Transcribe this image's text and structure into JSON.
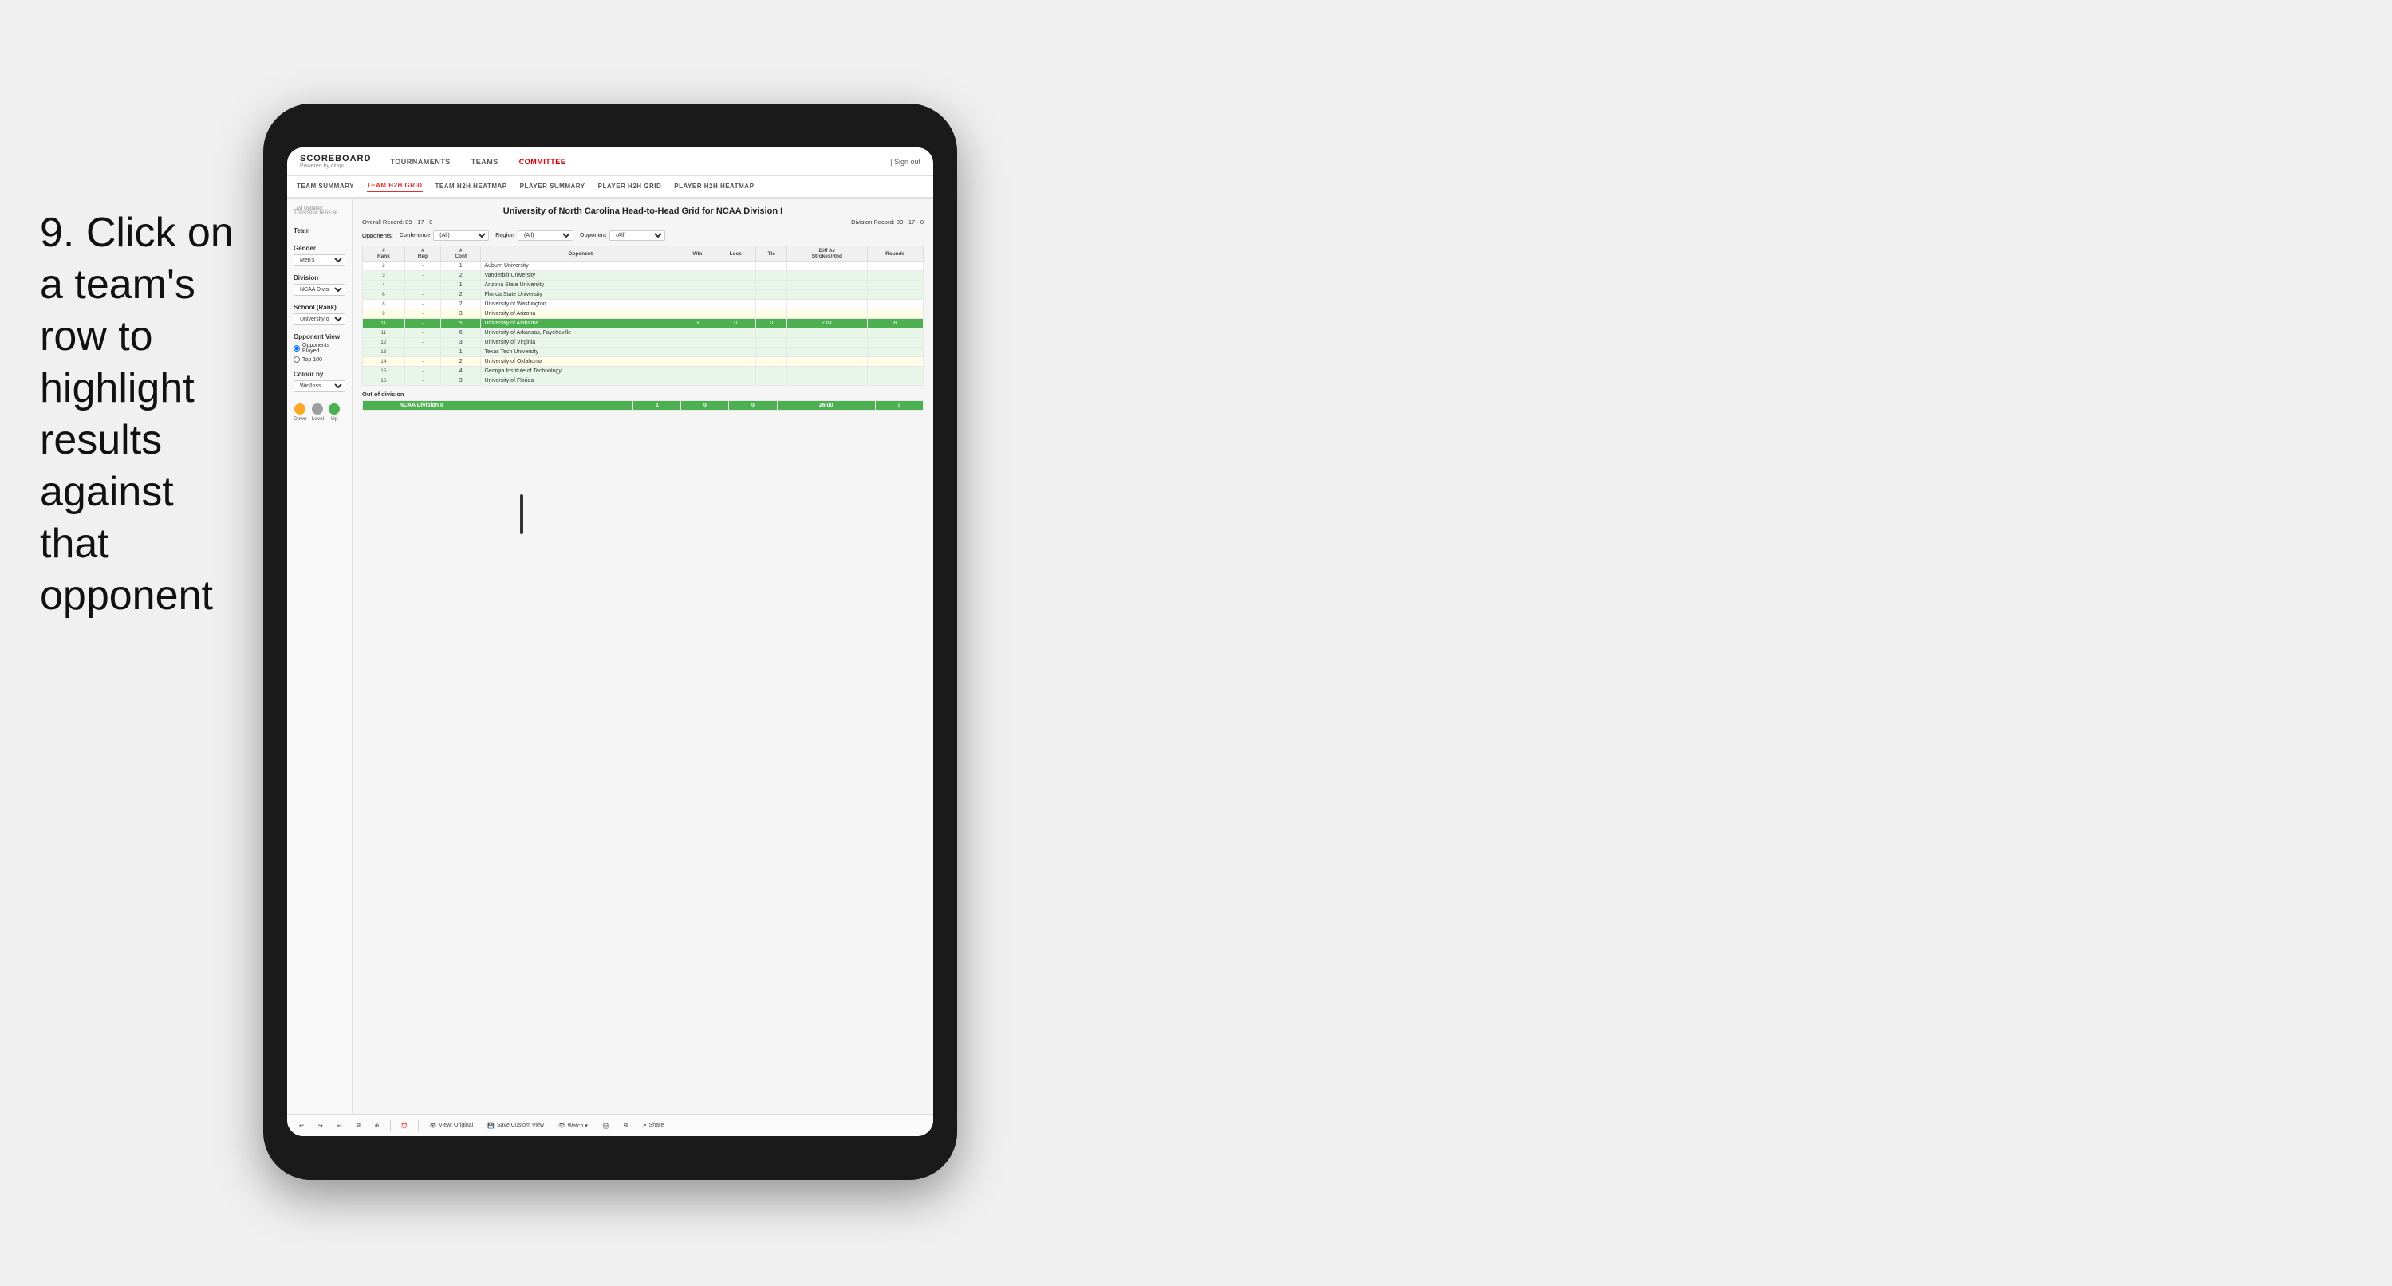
{
  "instruction": {
    "step": "9.",
    "text": "Click on a team's row to highlight results against that opponent"
  },
  "app": {
    "logo": {
      "title": "SCOREBOARD",
      "sub": "Powered by clippi"
    },
    "nav": {
      "links": [
        "TOURNAMENTS",
        "TEAMS",
        "COMMITTEE"
      ],
      "active": "COMMITTEE",
      "sign_out": "Sign out"
    },
    "sub_nav": {
      "links": [
        "TEAM SUMMARY",
        "TEAM H2H GRID",
        "TEAM H2H HEATMAP",
        "PLAYER SUMMARY",
        "PLAYER H2H GRID",
        "PLAYER H2H HEATMAP"
      ],
      "active": "TEAM H2H GRID"
    }
  },
  "sidebar": {
    "meta": "Last Updated: 27/03/2024 16:55:38",
    "team_section": "Team",
    "gender_label": "Gender",
    "gender_value": "Men's",
    "division_label": "Division",
    "division_value": "NCAA Division I",
    "school_label": "School (Rank)",
    "school_value": "University of Nort...",
    "opponent_view_label": "Opponent View",
    "opponents_played": "Opponents Played",
    "top_100": "Top 100",
    "colour_by_label": "Colour by",
    "colour_by_value": "Win/loss",
    "legend": [
      {
        "label": "Down",
        "color": "#f9a825"
      },
      {
        "label": "Level",
        "color": "#9e9e9e"
      },
      {
        "label": "Up",
        "color": "#4caf50"
      }
    ]
  },
  "panel": {
    "title": "University of North Carolina Head-to-Head Grid for NCAA Division I",
    "overall_record": "Overall Record: 89 - 17 - 0",
    "division_record": "Division Record: 88 - 17 - 0",
    "filters": {
      "conference_label": "Conference",
      "conference_value": "(All)",
      "region_label": "Region",
      "region_value": "(All)",
      "opponent_label": "Opponent",
      "opponent_value": "(All)",
      "opponents_label": "Opponents:"
    },
    "table_headers": [
      "#Rank",
      "#Reg",
      "#Conf",
      "Opponent",
      "Win",
      "Loss",
      "Tie",
      "Diff Av Strokes/Rnd",
      "Rounds"
    ],
    "rows": [
      {
        "rank": "2",
        "reg": "-",
        "conf": "1",
        "opponent": "Auburn University",
        "win": "",
        "loss": "",
        "tie": "",
        "diff": "",
        "rounds": "",
        "style": "normal"
      },
      {
        "rank": "3",
        "reg": "-",
        "conf": "2",
        "opponent": "Vanderbilt University",
        "win": "",
        "loss": "",
        "tie": "",
        "diff": "",
        "rounds": "",
        "style": "light-green"
      },
      {
        "rank": "4",
        "reg": "-",
        "conf": "1",
        "opponent": "Arizona State University",
        "win": "",
        "loss": "",
        "tie": "",
        "diff": "",
        "rounds": "",
        "style": "light-green"
      },
      {
        "rank": "6",
        "reg": "-",
        "conf": "2",
        "opponent": "Florida State University",
        "win": "",
        "loss": "",
        "tie": "",
        "diff": "",
        "rounds": "",
        "style": "light-green"
      },
      {
        "rank": "8",
        "reg": "-",
        "conf": "2",
        "opponent": "University of Washington",
        "win": "",
        "loss": "",
        "tie": "",
        "diff": "",
        "rounds": "",
        "style": "normal"
      },
      {
        "rank": "9",
        "reg": "-",
        "conf": "3",
        "opponent": "University of Arizona",
        "win": "",
        "loss": "",
        "tie": "",
        "diff": "",
        "rounds": "",
        "style": "light-yellow"
      },
      {
        "rank": "11",
        "reg": "-",
        "conf": "5",
        "opponent": "University of Alabama",
        "win": "3",
        "loss": "0",
        "tie": "0",
        "diff": "2.61",
        "rounds": "8",
        "style": "highlighted"
      },
      {
        "rank": "11",
        "reg": "-",
        "conf": "6",
        "opponent": "University of Arkansas, Fayetteville",
        "win": "",
        "loss": "",
        "tie": "",
        "diff": "",
        "rounds": "",
        "style": "light-green"
      },
      {
        "rank": "12",
        "reg": "-",
        "conf": "3",
        "opponent": "University of Virginia",
        "win": "",
        "loss": "",
        "tie": "",
        "diff": "",
        "rounds": "",
        "style": "light-green"
      },
      {
        "rank": "13",
        "reg": "-",
        "conf": "1",
        "opponent": "Texas Tech University",
        "win": "",
        "loss": "",
        "tie": "",
        "diff": "",
        "rounds": "",
        "style": "light-green"
      },
      {
        "rank": "14",
        "reg": "-",
        "conf": "2",
        "opponent": "University of Oklahoma",
        "win": "",
        "loss": "",
        "tie": "",
        "diff": "",
        "rounds": "",
        "style": "light-yellow"
      },
      {
        "rank": "15",
        "reg": "-",
        "conf": "4",
        "opponent": "Georgia Institute of Technology",
        "win": "",
        "loss": "",
        "tie": "",
        "diff": "",
        "rounds": "",
        "style": "light-green"
      },
      {
        "rank": "16",
        "reg": "-",
        "conf": "3",
        "opponent": "University of Florida",
        "win": "",
        "loss": "",
        "tie": "",
        "diff": "",
        "rounds": "",
        "style": "light-green"
      }
    ],
    "out_of_division_label": "Out of division",
    "out_of_division_row": {
      "label": "NCAA Division II",
      "win": "1",
      "loss": "0",
      "tie": "0",
      "diff": "26.00",
      "rounds": "3"
    }
  },
  "toolbar": {
    "undo": "↩",
    "redo": "↪",
    "view_original": "View: Original",
    "save_custom_view": "Save Custom View",
    "watch": "Watch ▾",
    "share": "Share"
  }
}
